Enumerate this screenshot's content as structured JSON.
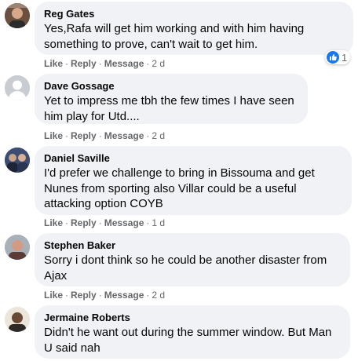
{
  "comments": [
    {
      "author": "Reg Gates",
      "text": "Yes,Rafa will get him working and with him having something to prove, can't wait to get him.",
      "actions": {
        "like": "Like",
        "reply": "Reply",
        "message": "Message",
        "time": "2 d"
      },
      "reaction_count": "1"
    },
    {
      "author": "Dave Gossage",
      "text": "Yet to impress me tbh the few times I have seen him play for Utd....",
      "actions": {
        "like": "Like",
        "reply": "Reply",
        "message": "Message",
        "time": "2 d"
      }
    },
    {
      "author": "Daniel Saville",
      "text": "I'd prefer we challenge to bring in Bissouma and get Nunes from sporting also Villar could be a useful attacking option COYB",
      "actions": {
        "like": "Like",
        "reply": "Reply",
        "message": "Message",
        "time": "1 d"
      }
    },
    {
      "author": "Stephen Baker",
      "text": "Sorry i dont think so he could be another disaster from Ajax",
      "actions": {
        "like": "Like",
        "reply": "Reply",
        "message": "Message",
        "time": "2 d"
      }
    },
    {
      "author": "Jermaine Roberts",
      "text": "Didn't he want out during the summer window. But Man U said nah",
      "actions": {}
    }
  ],
  "colors": {
    "bubble": "#f0f2f5",
    "meta": "#65676b",
    "like_blue": "#1877f2"
  },
  "icons": {
    "reaction": "like-thumb-icon"
  }
}
